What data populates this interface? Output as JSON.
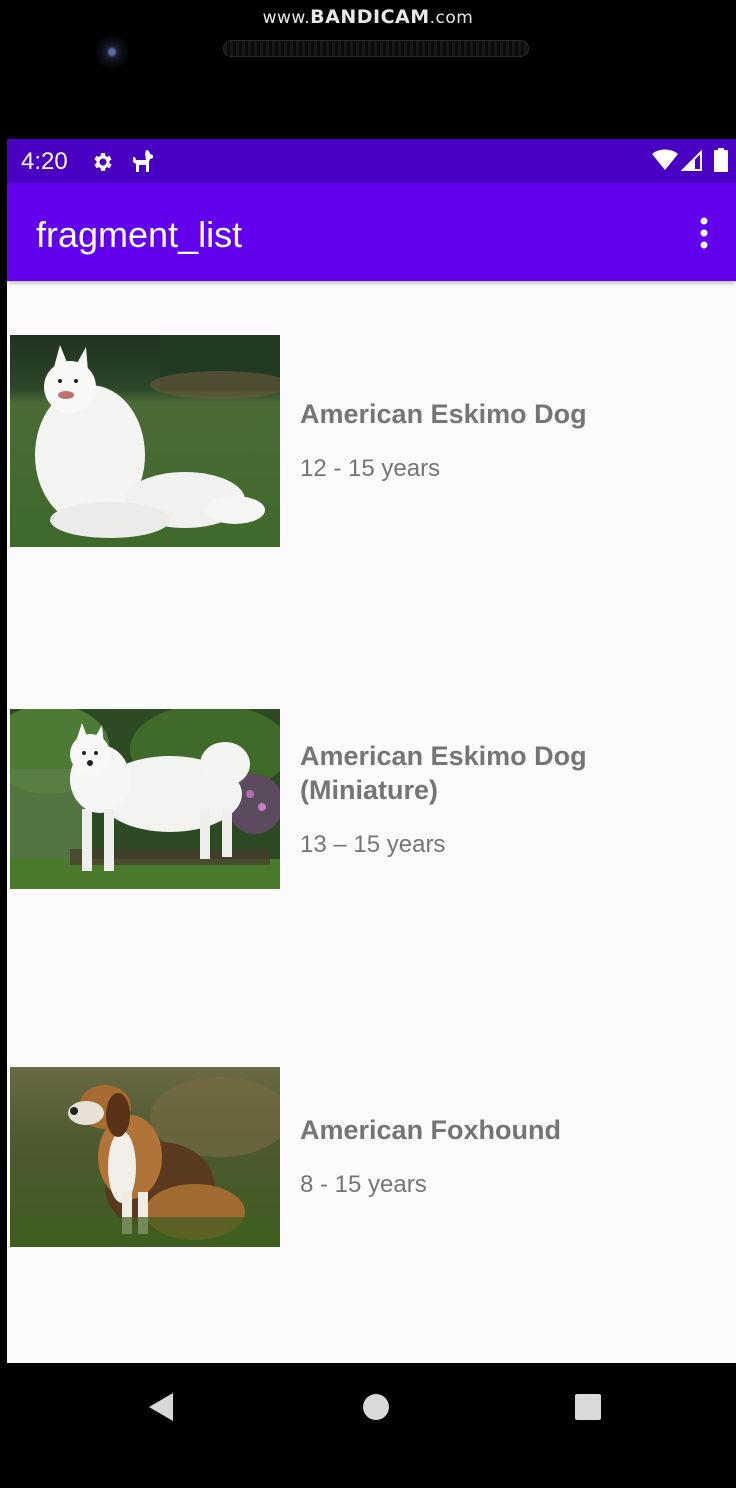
{
  "watermark": {
    "prefix": "www.",
    "brand": "BANDICAM",
    "suffix": ".com"
  },
  "status_bar": {
    "time": "4:20",
    "left_icons": [
      "settings-icon",
      "dog-icon"
    ],
    "right_icons": [
      "wifi-icon",
      "signal-icon",
      "battery-icon"
    ]
  },
  "app_bar": {
    "title": "fragment_list",
    "menu_icon": "more-vert-icon"
  },
  "breeds": [
    {
      "name": "American Eskimo Dog",
      "life_span": "12 - 15 years"
    },
    {
      "name": "American Eskimo Dog (Miniature)",
      "life_span": "13 – 15 years"
    },
    {
      "name": "American Foxhound",
      "life_span": "8 - 15 years"
    }
  ],
  "nav_bar": {
    "buttons": [
      "back-icon",
      "home-icon",
      "recents-icon"
    ]
  },
  "colors": {
    "status_bar": "#4a00c3",
    "app_bar": "#6200ee",
    "text_secondary": "#757575",
    "background": "#fbfbfb"
  }
}
